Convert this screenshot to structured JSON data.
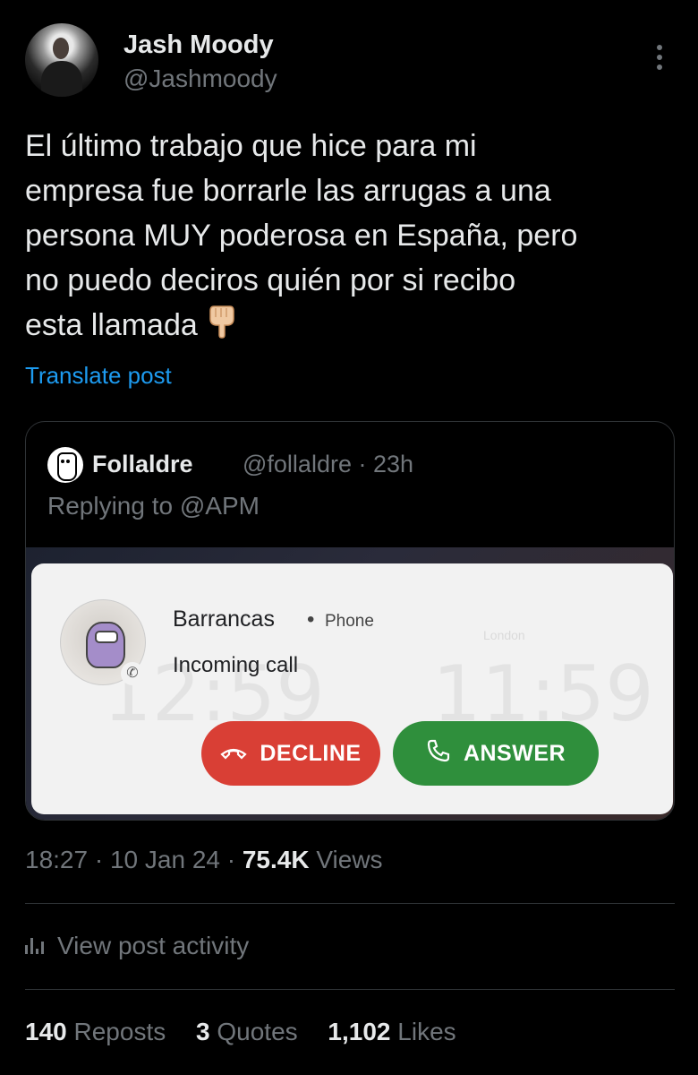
{
  "author": {
    "name": "Jash Moody",
    "handle": "@Jashmoody"
  },
  "tweet": {
    "lines": [
      "El último trabajo que hice para mi",
      "empresa fue borrarle las arrugas a una",
      "persona MUY poderosa en España, pero",
      "no puedo deciros quién por si recibo",
      "esta llamada"
    ],
    "emoji_icon": "pointing-down-hand-icon",
    "translate_label": "Translate post"
  },
  "quoted": {
    "name": "Follaldre",
    "handle": "@follaldre",
    "time": "· 23h",
    "replying_to_prefix": "Replying to",
    "replying_to_mention": "@APM",
    "call_card": {
      "caller": "Barrancas",
      "separator": "•",
      "source": "Phone",
      "status": "Incoming call",
      "decline_label": "DECLINE",
      "answer_label": "ANSWER",
      "decline_color": "#d93f35",
      "answer_color": "#2f8f3c"
    }
  },
  "meta": {
    "time": "18:27",
    "date": "10 Jan 24",
    "views_count": "75.4K",
    "views_label": "Views"
  },
  "activity": {
    "label": "View post activity"
  },
  "stats": {
    "reposts_count": "140",
    "reposts_label": "Reposts",
    "quotes_count": "3",
    "quotes_label": "Quotes",
    "likes_count": "1,102",
    "likes_label": "Likes"
  },
  "colors": {
    "background": "#000000",
    "link": "#1d9bf0",
    "muted": "#71767b",
    "text": "#e7e9ea"
  }
}
